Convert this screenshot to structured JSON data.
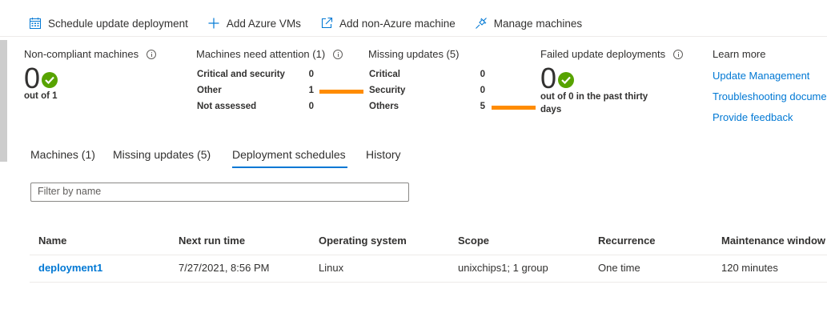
{
  "toolbar": {
    "schedule_label": "Schedule update deployment",
    "add_azure_label": "Add Azure VMs",
    "add_non_azure_label": "Add non-Azure machine",
    "manage_label": "Manage machines"
  },
  "summary": {
    "noncompliant": {
      "title": "Non-compliant machines",
      "count": "0",
      "sub": "out of 1"
    },
    "attention": {
      "title": "Machines need attention (1)",
      "rows": [
        {
          "label": "Critical and security",
          "value": "0"
        },
        {
          "label": "Other",
          "value": "1"
        },
        {
          "label": "Not assessed",
          "value": "0"
        }
      ]
    },
    "missing": {
      "title": "Missing updates (5)",
      "rows": [
        {
          "label": "Critical",
          "value": "0"
        },
        {
          "label": "Security",
          "value": "0"
        },
        {
          "label": "Others",
          "value": "5"
        }
      ]
    },
    "failed": {
      "title": "Failed update deployments",
      "count": "0",
      "sub": "out of 0 in the past thirty days"
    },
    "learn_more": {
      "title": "Learn more",
      "links": [
        "Update Management",
        "Troubleshooting docume",
        "Provide feedback"
      ]
    }
  },
  "tabs": [
    "Machines (1)",
    "Missing updates (5)",
    "Deployment schedules",
    "History"
  ],
  "active_tab": "Deployment schedules",
  "filter": {
    "placeholder": "Filter by name",
    "value": ""
  },
  "table": {
    "headers": [
      "Name",
      "Next run time",
      "Operating system",
      "Scope",
      "Recurrence",
      "Maintenance window"
    ],
    "rows": [
      [
        "deployment1",
        "7/27/2021, 8:56 PM",
        "Linux",
        "unixchips1; 1 group",
        "One time",
        "120 minutes"
      ]
    ]
  },
  "colors": {
    "accent": "#0078d4",
    "warning_bar": "#ff8c00",
    "ok": "#57a300"
  }
}
